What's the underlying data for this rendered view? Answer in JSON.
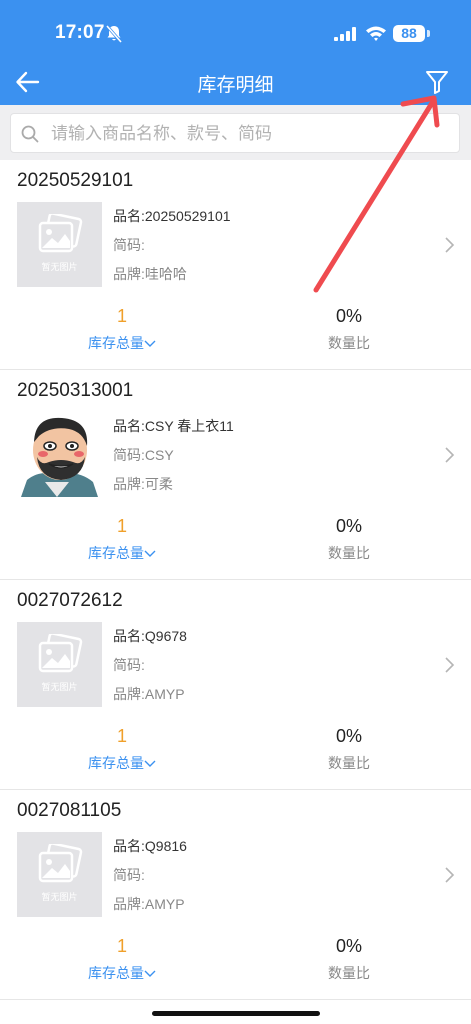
{
  "status": {
    "time": "17:07",
    "battery": "88"
  },
  "header": {
    "title": "库存明细"
  },
  "search": {
    "placeholder": "请输入商品名称、款号、简码"
  },
  "no_image_text": "暂无图片",
  "items": [
    {
      "code": "20250529101",
      "name": "品名:20250529101",
      "short": "简码:",
      "brand": "品牌:哇哈哈",
      "qty": "1",
      "qty_label": "库存总量",
      "ratio": "0%",
      "ratio_label": "数量比",
      "image": "placeholder"
    },
    {
      "code": "20250313001",
      "name": "品名:CSY 春上衣11",
      "short": "简码:CSY",
      "brand": "品牌:可柔",
      "qty": "1",
      "qty_label": "库存总量",
      "ratio": "0%",
      "ratio_label": "数量比",
      "image": "cartoon-avatar"
    },
    {
      "code": "0027072612",
      "name": "品名:Q9678",
      "short": "简码:",
      "brand": "品牌:AMYP",
      "qty": "1",
      "qty_label": "库存总量",
      "ratio": "0%",
      "ratio_label": "数量比",
      "image": "placeholder"
    },
    {
      "code": "0027081105",
      "name": "品名:Q9816",
      "short": "简码:",
      "brand": "品牌:AMYP",
      "qty": "1",
      "qty_label": "库存总量",
      "ratio": "0%",
      "ratio_label": "数量比",
      "image": "placeholder"
    }
  ],
  "colors": {
    "header_bg": "#3b91f0",
    "accent": "#3b91f0",
    "qty": "#f0a02a",
    "annotation_arrow": "#ef4b4f"
  }
}
